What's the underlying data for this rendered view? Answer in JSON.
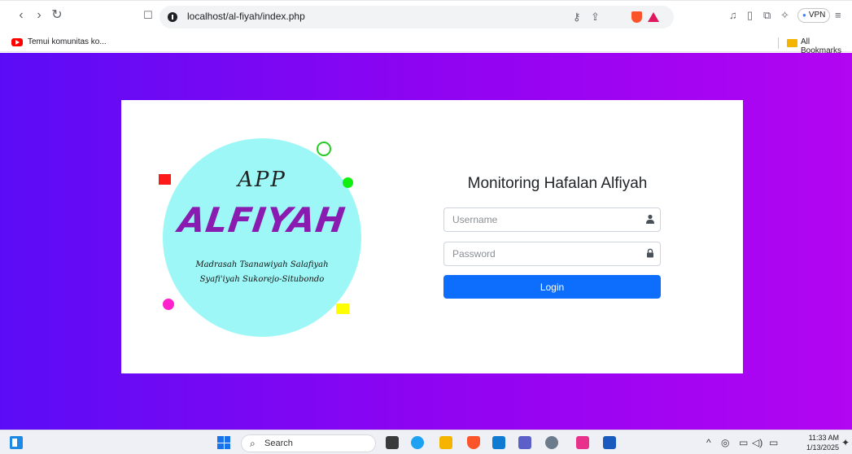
{
  "browser": {
    "url": "localhost/al-fiyah/index.php",
    "vpn_label": "VPN",
    "bookmark": "Temui komunitas ko...",
    "all_bookmarks": "All Bookmarks"
  },
  "logo": {
    "app": "APP",
    "name": "ALFIYAH",
    "subtitle_line1": "Madrasah Tsanawiyah Salafiyah",
    "subtitle_line2": "Syafi'iyah Sukorejo-Situbondo"
  },
  "form": {
    "title": "Monitoring Hafalan Alfiyah",
    "username_placeholder": "Username",
    "password_placeholder": "Password",
    "login_label": "Login"
  },
  "taskbar": {
    "search_label": "Search",
    "time": "11:33 AM",
    "date": "1/13/2025"
  },
  "colors": {
    "gradient_start": "#5b0cf6",
    "gradient_end": "#b205f2",
    "button": "#0d6efd",
    "logo_circle": "#9ef7f7",
    "logo_text": "#8a1bb0"
  }
}
